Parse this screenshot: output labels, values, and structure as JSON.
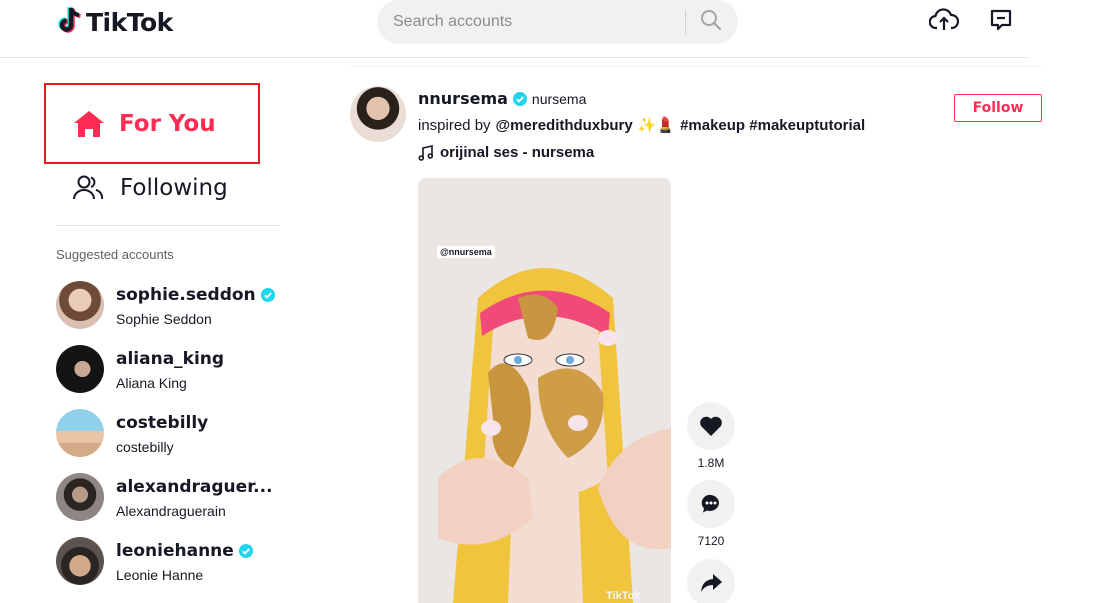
{
  "header": {
    "logo_text": "TikTok",
    "search_placeholder": "Search accounts",
    "upload_icon": "cloud-upload-icon",
    "messages_icon": "message-icon"
  },
  "nav": {
    "for_you": "For You",
    "following": "Following"
  },
  "sidebar": {
    "suggested_title": "Suggested accounts",
    "accounts": [
      {
        "username": "sophie.seddon",
        "display_name": "Sophie Seddon",
        "verified": true
      },
      {
        "username": "aliana_king",
        "display_name": "Aliana King",
        "verified": false
      },
      {
        "username": "costebilly",
        "display_name": "costebilly",
        "verified": false
      },
      {
        "username": "alexandraguer...",
        "display_name": "Alexandraguerain",
        "verified": false
      },
      {
        "username": "leoniehanne",
        "display_name": "Leonie Hanne",
        "verified": true
      }
    ]
  },
  "post": {
    "username": "nnursema",
    "nickname": "nursema",
    "verified": true,
    "caption_prefix": "inspired by",
    "caption_mention": "@meredithduxbury",
    "caption_emojis": "✨💄",
    "caption_tags": "#makeup #makeuptutorial",
    "music": "orijinal ses - nursema",
    "follow_label": "Follow",
    "video_handle": "@nnursema",
    "video_watermark": "TikTok",
    "likes": "1.8M",
    "comments": "7120"
  },
  "colors": {
    "brand": "#fe2c55",
    "verified": "#20d5ec",
    "highlight_border": "#e01b1b"
  }
}
